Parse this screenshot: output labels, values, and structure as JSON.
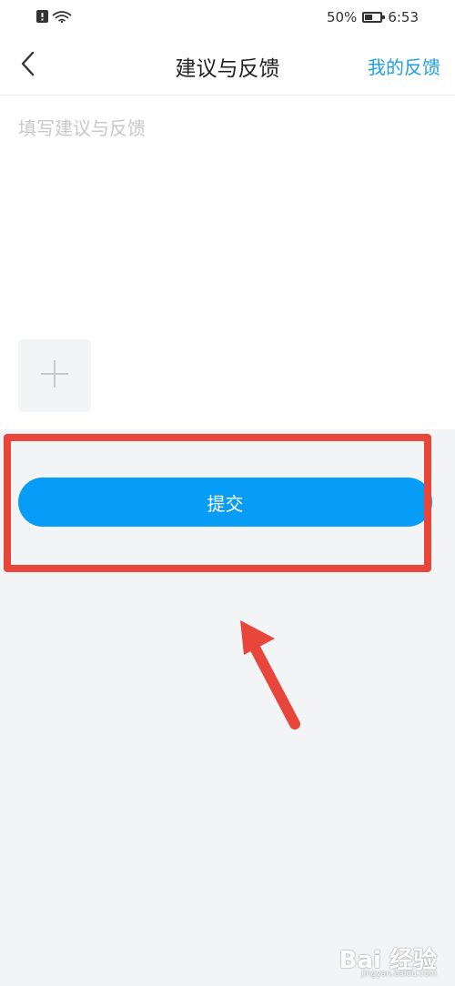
{
  "status_bar": {
    "battery_percent": "50%",
    "battery_level": 0.5,
    "time": "6:53",
    "icons": [
      "alert-sim-icon",
      "wifi-icon"
    ]
  },
  "nav": {
    "title": "建议与反馈",
    "right_link": "我的反馈",
    "back_icon": "chevron-left-icon"
  },
  "feedback": {
    "placeholder": "填写建议与反馈",
    "value": "",
    "add_image_icon": "plus-icon"
  },
  "submit": {
    "label": "提交"
  },
  "colors": {
    "accent": "#079cf5",
    "link": "#1e9fe6",
    "annotation": "#e8463a",
    "background": "#f3f4f6"
  },
  "watermark": {
    "text": "Bai 经验",
    "url": "jingyan.baidu.com"
  }
}
